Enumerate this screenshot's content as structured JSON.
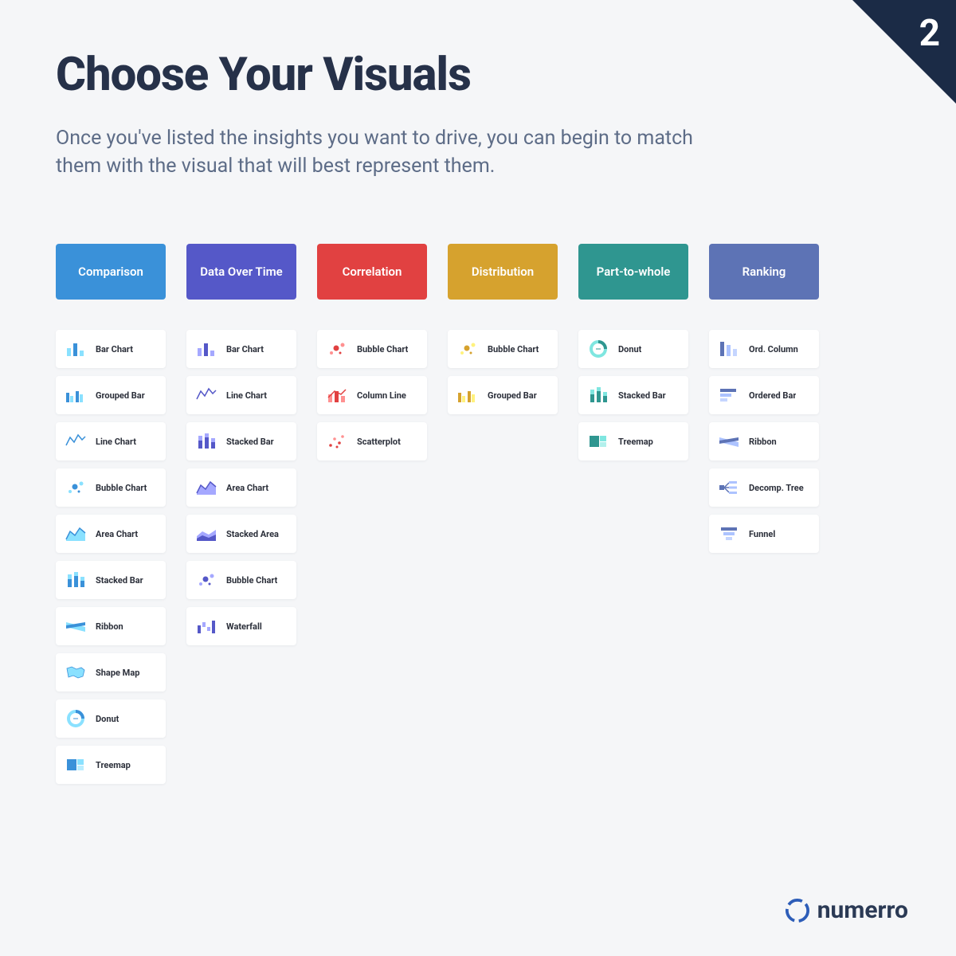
{
  "page_number": "2",
  "title": "Choose Your Visuals",
  "subtitle": "Once you've listed the insights you want to drive, you can begin to match them with the visual that will best represent them.",
  "brand": "numerro",
  "categories": [
    {
      "name": "Comparison",
      "color": "#3a91d9",
      "icon_color": "#3a91d9",
      "items": [
        {
          "label": "Bar Chart",
          "icon": "bar"
        },
        {
          "label": "Grouped Bar",
          "icon": "grouped-bar"
        },
        {
          "label": "Line Chart",
          "icon": "line"
        },
        {
          "label": "Bubble Chart",
          "icon": "bubble"
        },
        {
          "label": "Area Chart",
          "icon": "area"
        },
        {
          "label": "Stacked Bar",
          "icon": "stacked-bar"
        },
        {
          "label": "Ribbon",
          "icon": "ribbon"
        },
        {
          "label": "Shape Map",
          "icon": "map"
        },
        {
          "label": "Donut",
          "icon": "donut"
        },
        {
          "label": "Treemap",
          "icon": "treemap"
        }
      ]
    },
    {
      "name": "Data Over Time",
      "color": "#5558c8",
      "icon_color": "#5558c8",
      "items": [
        {
          "label": "Bar Chart",
          "icon": "bar"
        },
        {
          "label": "Line Chart",
          "icon": "line"
        },
        {
          "label": "Stacked Bar",
          "icon": "stacked-bar"
        },
        {
          "label": "Area Chart",
          "icon": "area"
        },
        {
          "label": "Stacked Area",
          "icon": "stacked-area"
        },
        {
          "label": "Bubble Chart",
          "icon": "bubble"
        },
        {
          "label": "Waterfall",
          "icon": "waterfall"
        }
      ]
    },
    {
      "name": "Correlation",
      "color": "#e14141",
      "icon_color": "#e14141",
      "items": [
        {
          "label": "Bubble Chart",
          "icon": "bubble"
        },
        {
          "label": "Column Line",
          "icon": "column-line"
        },
        {
          "label": "Scatterplot",
          "icon": "scatter"
        }
      ]
    },
    {
      "name": "Distribution",
      "color": "#d6a22e",
      "icon_color": "#d6a22e",
      "items": [
        {
          "label": "Bubble Chart",
          "icon": "bubble"
        },
        {
          "label": "Grouped Bar",
          "icon": "grouped-bar"
        }
      ]
    },
    {
      "name": "Part-to-whole",
      "color": "#2f9690",
      "icon_color": "#2f9690",
      "items": [
        {
          "label": "Donut",
          "icon": "donut"
        },
        {
          "label": "Stacked Bar",
          "icon": "stacked-bar"
        },
        {
          "label": "Treemap",
          "icon": "treemap"
        }
      ]
    },
    {
      "name": "Ranking",
      "color": "#5d73b5",
      "icon_color": "#5d73b5",
      "items": [
        {
          "label": "Ord. Column",
          "icon": "ord-column"
        },
        {
          "label": "Ordered Bar",
          "icon": "ordered-bar"
        },
        {
          "label": "Ribbon",
          "icon": "ribbon"
        },
        {
          "label": "Decomp. Tree",
          "icon": "decomp-tree"
        },
        {
          "label": "Funnel",
          "icon": "funnel"
        }
      ]
    }
  ]
}
